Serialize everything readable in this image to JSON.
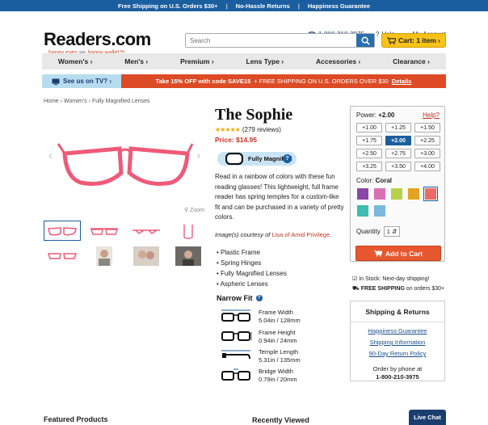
{
  "topbar": {
    "items": [
      "Free Shipping on U.S. Orders $30+",
      "No-Hassle Returns",
      "Happiness Guarantee"
    ]
  },
  "logo": {
    "text": "Readers.com",
    "tagline": "happy eyes 👓 happy wallet™"
  },
  "header": {
    "phone": "1-800-210-3975",
    "help": "Help",
    "account": "My Account"
  },
  "search": {
    "placeholder": "Search"
  },
  "cart": {
    "label": "Cart: 1 item ›"
  },
  "nav": {
    "items": [
      "Women's ›",
      "Men's ›",
      "Premium ›",
      "Lens Type ›",
      "Accessories ›",
      "Clearance ›"
    ]
  },
  "promo": {
    "tv": "See us on TV? ›",
    "deal_bold": "Take 15% OFF with code SAVE15",
    "deal_rest": "+ FREE SHIPPING ON U.S. ORDERS OVER $30",
    "details": "Details"
  },
  "breadcrumb": "Home › Women's › Fully Magnified Lenses",
  "product": {
    "title": "The Sophie",
    "stars": "★★★★★",
    "reviews": "(279 reviews)",
    "price": "Price: $14.95",
    "lens_badge": "Fully Magnified",
    "lens_badge_help": "?",
    "description": "Read in a rainbow of colors with these fun reading glasses! This lightweight, full frame reader has spring temples for a custom-like fit and can be purchased in a variety of pretty colors.",
    "credit_prefix": "Image(s) courtesy of",
    "credit_link": "Lisa of Amid Privilege",
    "zoom": "Zoom",
    "features": [
      "Plastic Frame",
      "Spring Hinges",
      "Fully Magnified Lenses",
      "Aspheric Lenses"
    ],
    "fit_title": "Narrow Fit",
    "specs": [
      {
        "label": "Frame Width",
        "value": "5.04in / 128mm"
      },
      {
        "label": "Frame Height",
        "value": "0.94in / 24mm"
      },
      {
        "label": "Temple Length",
        "value": "5.31in / 135mm"
      },
      {
        "label": "Bridge Width",
        "value": "0.79in / 20mm"
      }
    ]
  },
  "power": {
    "label": "Power:",
    "selected": "+2.00",
    "help": "Help?",
    "options": [
      "+1.00",
      "+1.25",
      "+1.50",
      "+1.75",
      "+2.00",
      "+2.25",
      "+2.50",
      "+2.75",
      "+3.00",
      "+3.25",
      "+3.50",
      "+4.00"
    ],
    "selected_index": 4
  },
  "color": {
    "label": "Color:",
    "selected": "Coral",
    "swatches": [
      "#8b47a8",
      "#d96fb5",
      "#b8cf4c",
      "#e5a323",
      "#ef6a66",
      "#3fbdb2",
      "#7ab8e0"
    ],
    "selected_index": 4
  },
  "quantity": {
    "label": "Quantity",
    "value": "1"
  },
  "add_to_cart": "Add to Cart",
  "shipping_note": {
    "line1": "In Stock: Next-day shipping!",
    "line2_bold": "FREE SHIPPING",
    "line2_rest": "on orders $30+"
  },
  "shipbox": {
    "title": "Shipping & Returns",
    "links": [
      "Happiness Guarantee",
      "Shipping Information",
      "90-Day Return Policy"
    ],
    "phone_label": "Order by phone at",
    "phone": "1-800-210-3975"
  },
  "bottom": {
    "featured": "Featured Products",
    "recent": "Recently Viewed",
    "live_chat": "Live Chat"
  },
  "colors": {
    "brand_blue": "#1b5e9f",
    "coral": "#e6572e",
    "cart_yellow": "#f7c21a",
    "frame_pink": "#ef5a78"
  }
}
